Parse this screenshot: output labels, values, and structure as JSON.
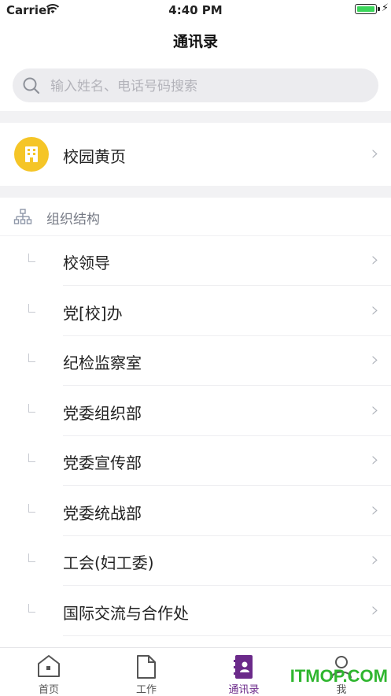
{
  "status_bar": {
    "carrier": "Carrier",
    "time": "4:40 PM",
    "battery_level": 1.0
  },
  "nav": {
    "title": "通讯录"
  },
  "search": {
    "placeholder": "输入姓名、电话号码搜索"
  },
  "yellow_pages": {
    "label": "校园黄页",
    "icon": "building-icon",
    "color": "#f5c527"
  },
  "org": {
    "header": "组织结构",
    "icon": "org-tree-icon",
    "items": [
      {
        "label": "校领导"
      },
      {
        "label": "党[校]办"
      },
      {
        "label": "纪检监察室"
      },
      {
        "label": "党委组织部"
      },
      {
        "label": "党委宣传部"
      },
      {
        "label": "党委统战部"
      },
      {
        "label": "工会(妇工委)"
      },
      {
        "label": "国际交流与合作处"
      }
    ]
  },
  "tabbar": {
    "items": [
      {
        "label": "首页",
        "icon": "home-icon",
        "active": false
      },
      {
        "label": "工作",
        "icon": "document-icon",
        "active": false
      },
      {
        "label": "通讯录",
        "icon": "contacts-book-icon",
        "active": true
      },
      {
        "label": "我",
        "icon": "person-icon",
        "active": false
      }
    ],
    "active_color": "#6b2a8a"
  },
  "watermark": {
    "text": "ITMOP.COM"
  }
}
